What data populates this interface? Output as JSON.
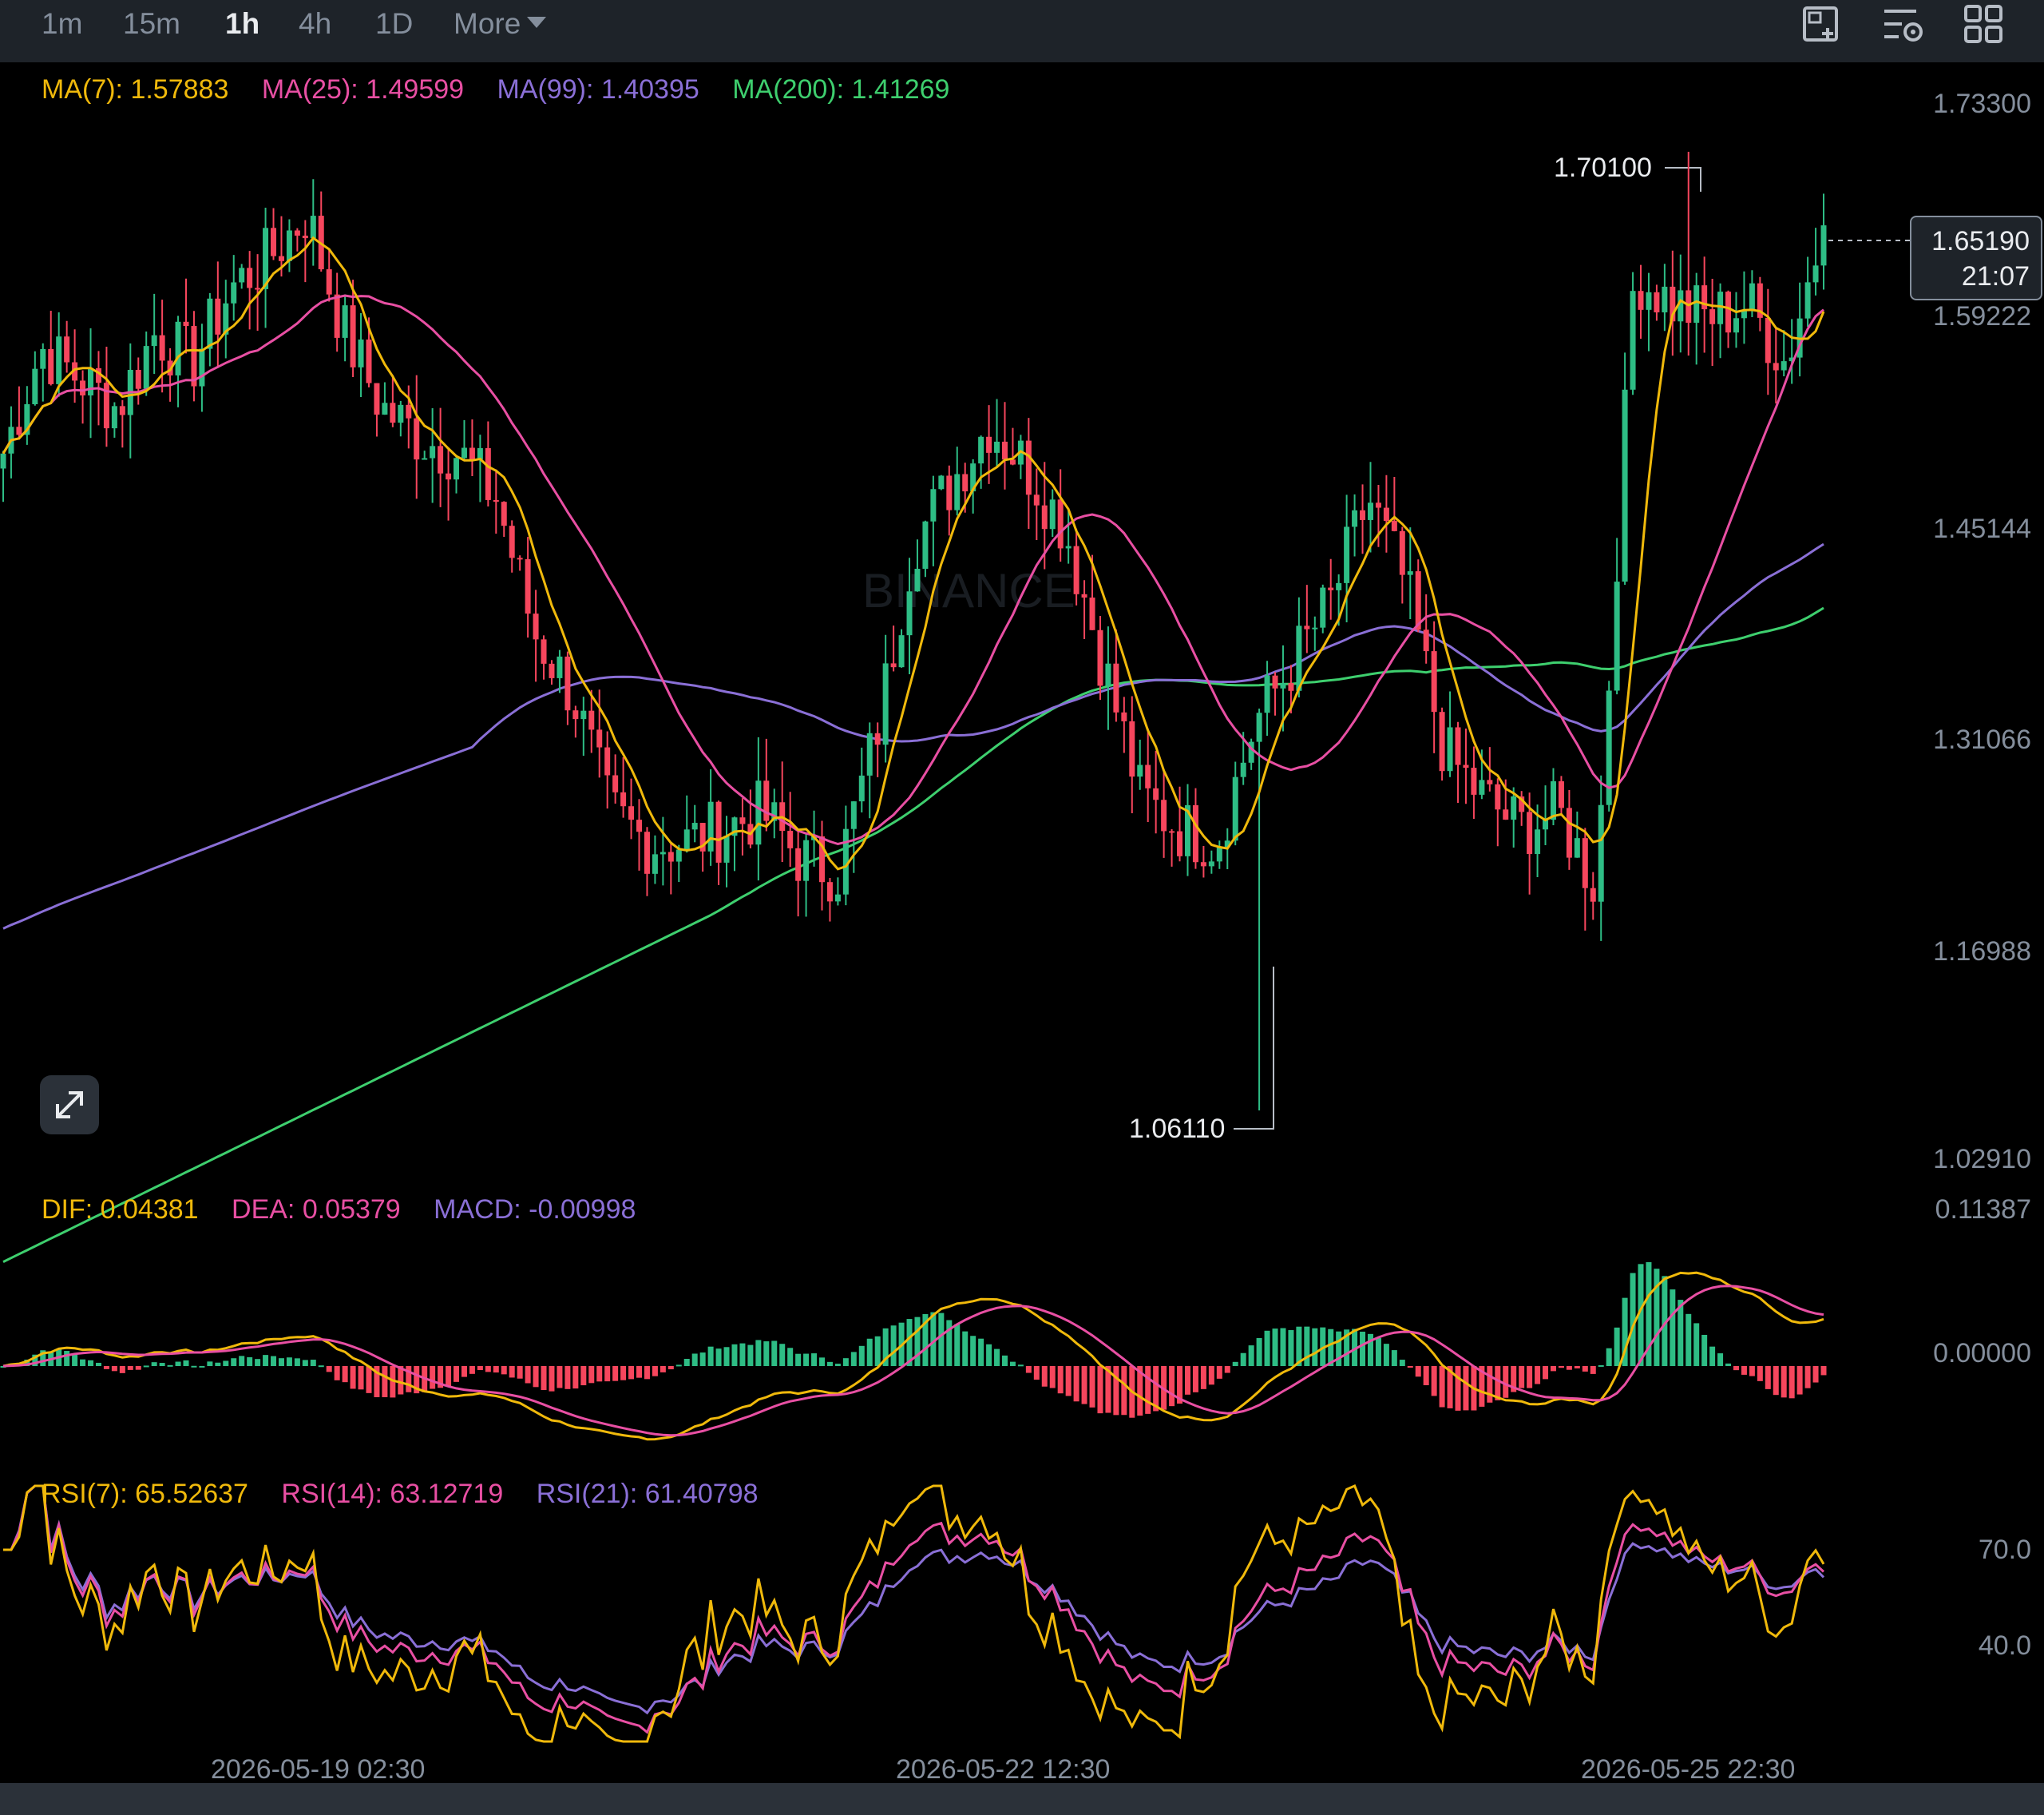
{
  "timeframes": [
    {
      "label": "1m",
      "active": false
    },
    {
      "label": "15m",
      "active": false
    },
    {
      "label": "1h",
      "active": true
    },
    {
      "label": "4h",
      "active": false
    },
    {
      "label": "1D",
      "active": false
    }
  ],
  "more_label": "More",
  "toolbar_icons": [
    "screenshot-icon",
    "indicator-settings-icon",
    "layout-grid-icon"
  ],
  "ma_legend": [
    {
      "label": "MA(7): 1.57883",
      "color": "#f0b90b"
    },
    {
      "label": "MA(25): 1.49599",
      "color": "#e84fa3"
    },
    {
      "label": "MA(99): 1.40395",
      "color": "#8a6fd6"
    },
    {
      "label": "MA(200): 1.41269",
      "color": "#3ecf6e"
    }
  ],
  "macd_legend": [
    {
      "label": "DIF: 0.04381",
      "color": "#f0b90b"
    },
    {
      "label": "DEA: 0.05379",
      "color": "#e84fa3"
    },
    {
      "label": "MACD: -0.00998",
      "color": "#8a6fd6"
    }
  ],
  "rsi_legend": [
    {
      "label": "RSI(7): 65.52637",
      "color": "#f0b90b"
    },
    {
      "label": "RSI(14): 63.12719",
      "color": "#e84fa3"
    },
    {
      "label": "RSI(21): 61.40798",
      "color": "#8a6fd6"
    }
  ],
  "price_axis": [
    "1.73300",
    "1.59222",
    "1.45144",
    "1.31066",
    "1.16988",
    "1.02910"
  ],
  "macd_axis": [
    "0.11387",
    "0.00000"
  ],
  "rsi_axis": [
    "70.0",
    "40.0"
  ],
  "time_axis": [
    "2026-05-19 02:30",
    "2026-05-22 12:30",
    "2026-05-25 22:30"
  ],
  "current_price": {
    "price": "1.65190",
    "countdown": "21:07"
  },
  "high_marker": "1.70100",
  "low_marker": "1.06110",
  "watermark": "BINANCE",
  "colors": {
    "up": "#2ebd85",
    "down": "#f6465d",
    "background": "#000000",
    "panel": "#1e2329"
  },
  "chart_data": {
    "type": "candlestick",
    "x_axis_ticks": [
      "2026-05-19 02:30",
      "2026-05-22 12:30",
      "2026-05-25 22:30"
    ],
    "price_range": [
      1.0291,
      1.733
    ],
    "price_ticks": [
      1.733,
      1.59222,
      1.45144,
      1.31066,
      1.16988,
      1.0291
    ],
    "close_anchors": [
      1.5,
      1.57,
      1.55,
      1.53,
      1.58,
      1.56,
      1.61,
      1.63,
      1.66,
      1.58,
      1.53,
      1.51,
      1.5,
      1.47,
      1.38,
      1.34,
      1.26,
      1.24,
      1.24,
      1.25,
      1.26,
      1.23,
      1.22,
      1.31,
      1.44,
      1.48,
      1.52,
      1.49,
      1.45,
      1.36,
      1.27,
      1.25,
      1.24,
      1.32,
      1.36,
      1.4,
      1.47,
      1.41,
      1.3,
      1.27,
      1.25,
      1.26,
      1.21,
      1.62,
      1.6,
      1.59,
      1.6,
      1.56,
      1.652
    ],
    "high": 1.701,
    "low": 1.0611,
    "last": 1.6519,
    "moving_averages": {
      "MA(7)": 1.57883,
      "MA(25)": 1.49599,
      "MA(99)": 1.40395,
      "MA(200)": 1.41269
    },
    "macd": {
      "DIF": 0.04381,
      "DEA": 0.05379,
      "MACD": -0.00998,
      "axis_ticks": [
        0.11387,
        0.0
      ]
    },
    "rsi": {
      "RSI(7)": 65.52637,
      "RSI(14)": 63.12719,
      "RSI(21)": 61.40798,
      "axis_ticks": [
        70.0,
        40.0
      ]
    }
  }
}
